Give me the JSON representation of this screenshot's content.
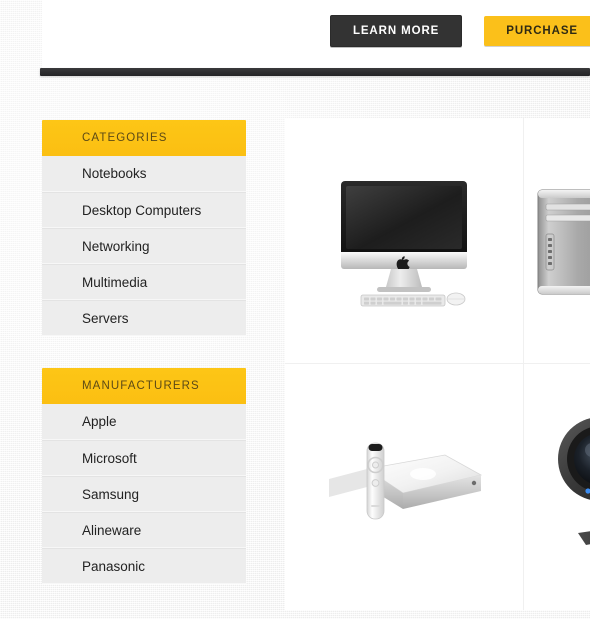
{
  "header": {
    "learn_more_label": "LEARN MORE",
    "purchase_label": "PURCHASE"
  },
  "sidebar": {
    "widgets": [
      {
        "title": "CATEGORIES",
        "items": [
          {
            "label": "Notebooks"
          },
          {
            "label": "Desktop Computers"
          },
          {
            "label": "Networking"
          },
          {
            "label": "Multimedia"
          },
          {
            "label": "Servers"
          }
        ]
      },
      {
        "title": "MANUFACTURERS",
        "items": [
          {
            "label": "Apple"
          },
          {
            "label": "Microsoft"
          },
          {
            "label": "Samsung"
          },
          {
            "label": "Alineware"
          },
          {
            "label": "Panasonic"
          }
        ]
      }
    ]
  },
  "products": [
    {
      "name": "all-in-one-desktop-computer",
      "icon": "imac-desktop-icon",
      "clipped": false
    },
    {
      "name": "tower-workstation",
      "icon": "tower-computer-icon",
      "clipped": true
    },
    {
      "name": "media-player-with-remote",
      "icon": "mac-mini-remote-icon",
      "clipped": false
    },
    {
      "name": "hd-webcam",
      "icon": "hd-webcam-icon",
      "clipped": true
    }
  ],
  "colors": {
    "accent_yellow": "#fbc01a",
    "dark_bar": "#2c2c2e",
    "button_dark": "#333333",
    "sidebar_item_bg": "#ededed",
    "page_bg": "#f3f3f3"
  }
}
